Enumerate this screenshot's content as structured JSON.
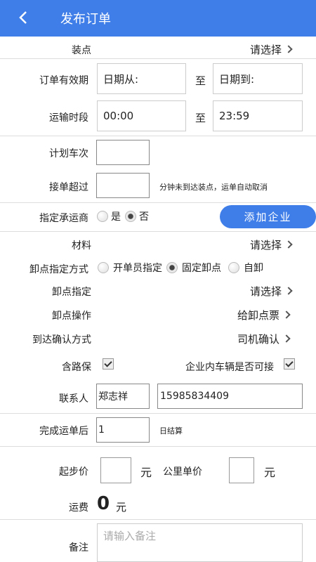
{
  "header": {
    "title": "发布订单"
  },
  "load_point": {
    "label": "装点",
    "value": "请选择"
  },
  "validity": {
    "label": "订单有效期",
    "from": "日期从:",
    "sep": "至",
    "to": "日期到:"
  },
  "transport_time": {
    "label": "运输时段",
    "from": "00:00",
    "sep": "至",
    "to": "23:59"
  },
  "plan_trips": {
    "label": "计划车次",
    "value": ""
  },
  "accept_timeout": {
    "label": "接单超过",
    "value": "",
    "note": "分钟未到达装点，运单自动取消"
  },
  "carrier": {
    "label": "指定承运商",
    "yes": "是",
    "no": "否",
    "selected": "否",
    "add_button": "添加企业"
  },
  "material": {
    "label": "材料",
    "value": "请选择"
  },
  "unload_mode": {
    "label": "卸点指定方式",
    "options": [
      "开单员指定",
      "固定卸点",
      "自卸"
    ],
    "selected": "固定卸点"
  },
  "unload_point": {
    "label": "卸点指定",
    "value": "请选择"
  },
  "unload_action": {
    "label": "卸点操作",
    "value": "给卸点票"
  },
  "arrival_confirm": {
    "label": "到达确认方式",
    "value": "司机确认"
  },
  "road_insurance": {
    "label": "含路保",
    "checked": true
  },
  "internal_vehicle": {
    "label": "企业内车辆是否可接",
    "checked": true
  },
  "contact": {
    "label": "联系人",
    "name": "郑志祥",
    "phone": "15985834409"
  },
  "settlement": {
    "label": "完成运单后",
    "value": "1",
    "unit": "日结算"
  },
  "pricing": {
    "start_label": "起步价",
    "start_value": "",
    "start_unit": "元",
    "km_label": "公里单价",
    "km_value": "",
    "km_unit": "元"
  },
  "freight": {
    "label": "运费",
    "value": "0",
    "unit": "元"
  },
  "remark": {
    "label": "备注",
    "placeholder": "请输入备注"
  }
}
